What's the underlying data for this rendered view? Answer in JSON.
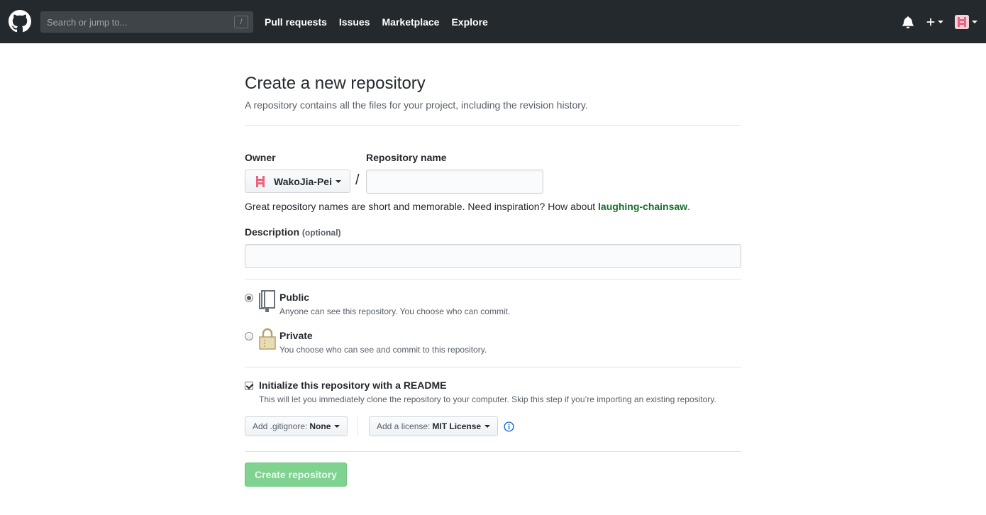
{
  "header": {
    "search_placeholder": "Search or jump to...",
    "search_key": "/",
    "nav": [
      "Pull requests",
      "Issues",
      "Marketplace",
      "Explore"
    ]
  },
  "page": {
    "title": "Create a new repository",
    "subtitle": "A repository contains all the files for your project, including the revision history."
  },
  "form": {
    "owner_label": "Owner",
    "owner_value": "WakoJia-Pei",
    "separator": "/",
    "repo_name_label": "Repository name",
    "repo_name_value": "",
    "hint_prefix": "Great repository names are short and memorable. Need inspiration? How about ",
    "hint_suggestion": "laughing-chainsaw",
    "hint_suffix": ".",
    "description_label": "Description",
    "description_optional": "(optional)",
    "description_value": "",
    "visibility": {
      "selected": "public",
      "public_title": "Public",
      "public_desc": "Anyone can see this repository. You choose who can commit.",
      "private_title": "Private",
      "private_desc": "You choose who can see and commit to this repository."
    },
    "init_readme_checked": true,
    "init_readme_title": "Initialize this repository with a README",
    "init_readme_desc": "This will let you immediately clone the repository to your computer. Skip this step if you’re importing an existing repository.",
    "gitignore_prefix": "Add .gitignore:",
    "gitignore_value": "None",
    "license_prefix": "Add a license:",
    "license_value": "MIT License",
    "create_button": "Create repository"
  },
  "colors": {
    "header_bg": "#24292e",
    "suggestion": "#176f2c",
    "create_button_disabled": "#7fd290",
    "avatar_pink": "#e8647f"
  }
}
